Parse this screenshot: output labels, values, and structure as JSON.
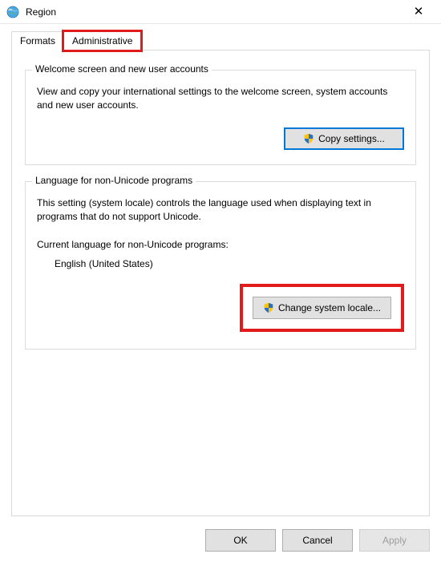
{
  "title": "Region",
  "tabs": {
    "formats": "Formats",
    "administrative": "Administrative"
  },
  "group1": {
    "legend": "Welcome screen and new user accounts",
    "desc": "View and copy your international settings to the welcome screen, system accounts and new user accounts.",
    "button": "Copy settings..."
  },
  "group2": {
    "legend": "Language for non-Unicode programs",
    "desc": "This setting (system locale) controls the language used when displaying text in programs that do not support Unicode.",
    "current_label": "Current language for non-Unicode programs:",
    "current_value": "English (United States)",
    "button": "Change system locale..."
  },
  "footer": {
    "ok": "OK",
    "cancel": "Cancel",
    "apply": "Apply"
  }
}
